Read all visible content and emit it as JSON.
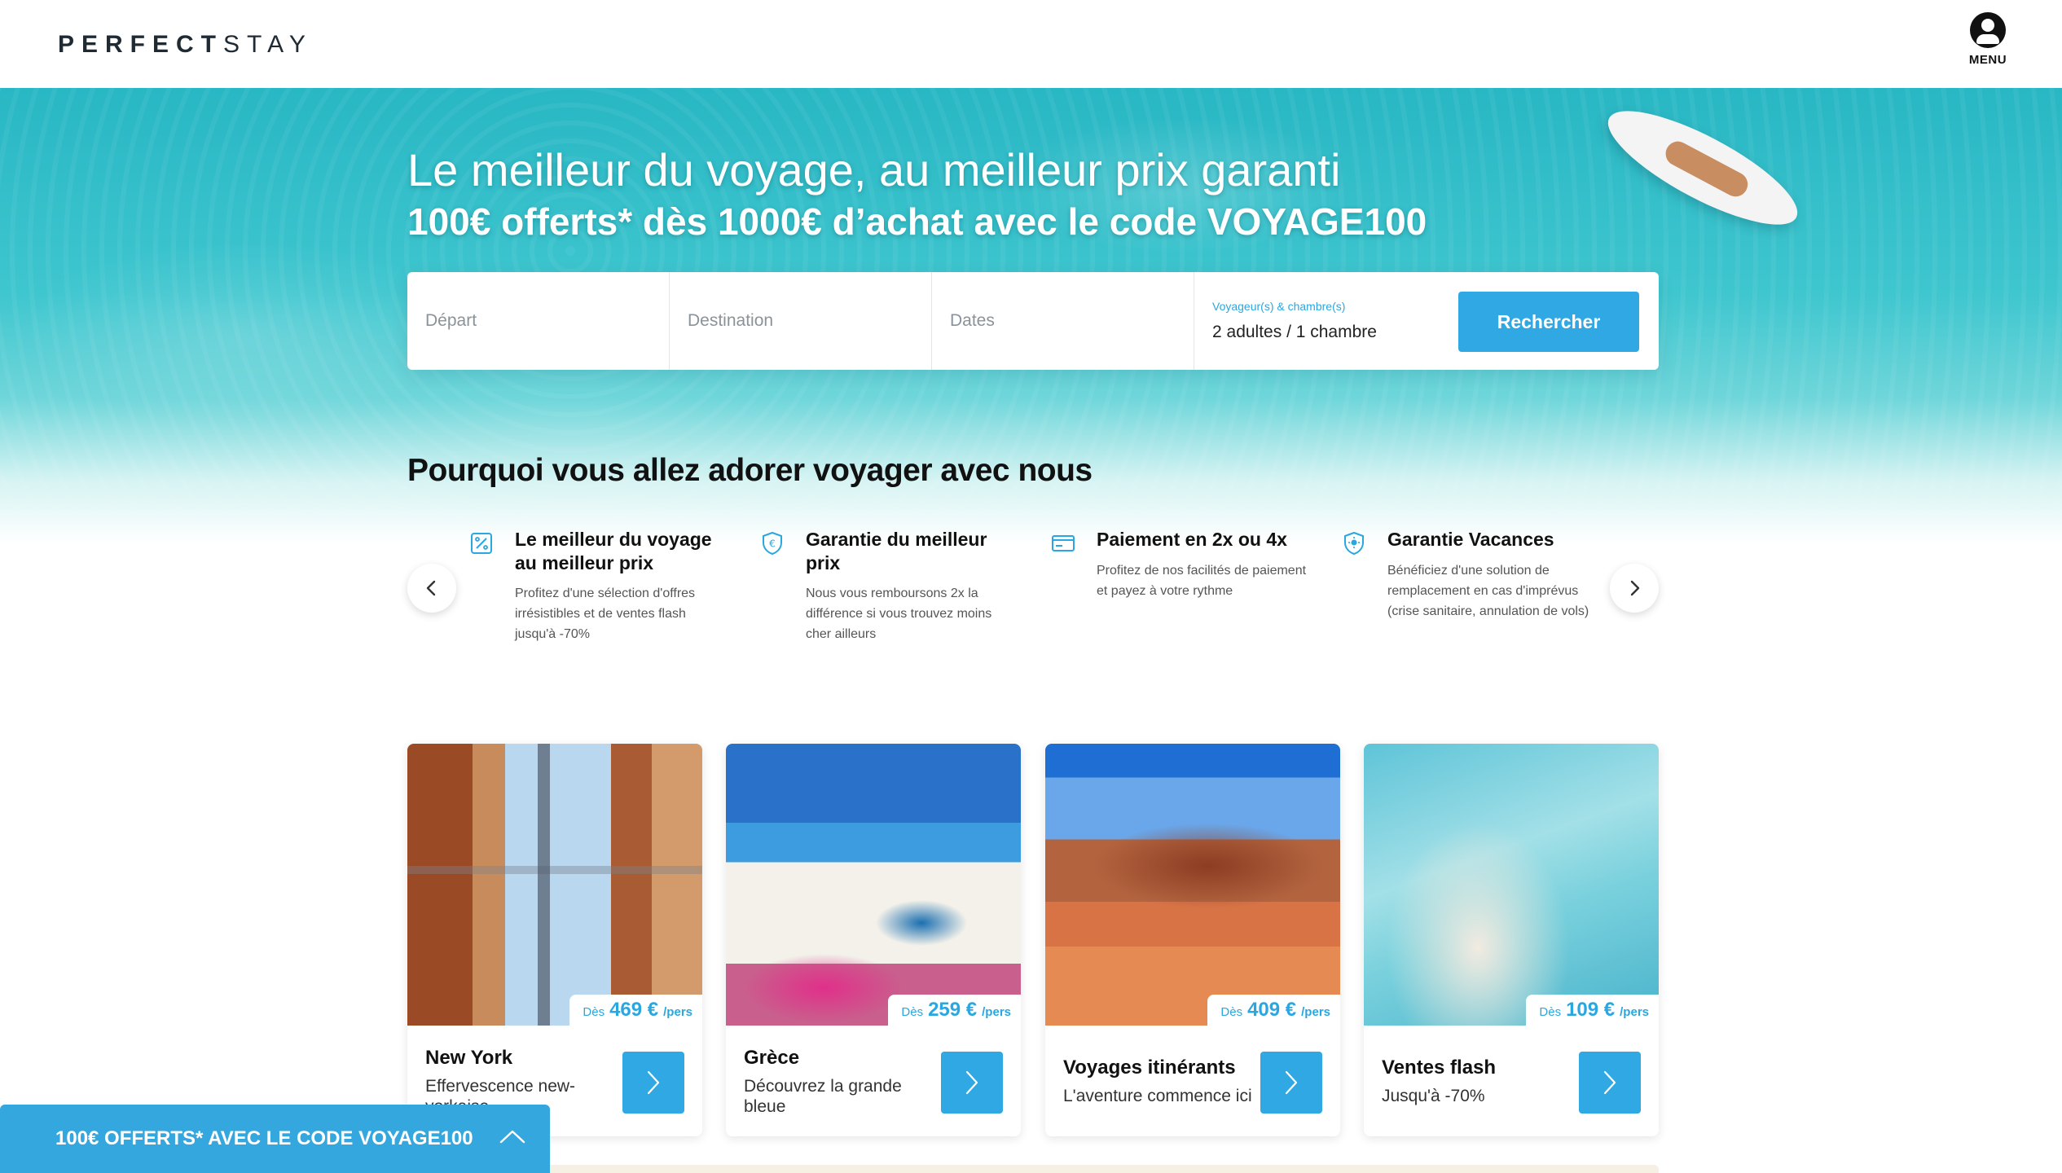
{
  "header": {
    "logo_bold": "PERFECT",
    "logo_light": "STAY",
    "menu_label": "MENU"
  },
  "hero": {
    "title": "Le meilleur du voyage, au meilleur prix garanti",
    "subtitle": "100€ offerts* dès 1000€ d’achat avec le code VOYAGE100"
  },
  "search": {
    "departure_placeholder": "Départ",
    "destination_placeholder": "Destination",
    "dates_placeholder": "Dates",
    "travelers_label": "Voyageur(s) & chambre(s)",
    "travelers_value": "2 adultes / 1 chambre",
    "button_label": "Rechercher"
  },
  "why": {
    "title": "Pourquoi vous allez adorer voyager avec nous",
    "features": [
      {
        "icon": "percent-icon",
        "title": "Le meilleur du voyage au meilleur prix",
        "text": "Profitez d'une sélection d'offres irrésistibles et de ventes flash jusqu'à -70%"
      },
      {
        "icon": "euro-shield-icon",
        "title": "Garantie du meilleur prix",
        "text": "Nous vous remboursons 2x la différence si vous trouvez moins cher ailleurs"
      },
      {
        "icon": "credit-card-icon",
        "title": "Paiement en 2x ou 4x",
        "text": "Profitez de nos facilités de paiement et payez à votre rythme"
      },
      {
        "icon": "sun-shield-icon",
        "title": "Garantie Vacances",
        "text": "Bénéficiez d'une solution de remplacement en cas d'imprévus (crise sanitaire, annulation de vols)"
      }
    ]
  },
  "cards": [
    {
      "title": "New York",
      "desc": "Effervescence new-yorkaise",
      "price_prefix": "Dès",
      "price": "469 €",
      "price_suffix": "/pers"
    },
    {
      "title": "Grèce",
      "desc": "Découvrez la grande bleue",
      "price_prefix": "Dès",
      "price": "259 €",
      "price_suffix": "/pers"
    },
    {
      "title": "Voyages itinérants",
      "desc": "L'aventure commence ici",
      "price_prefix": "Dès",
      "price": "409 €",
      "price_suffix": "/pers"
    },
    {
      "title": "Ventes flash",
      "desc": "Jusqu'à -70%",
      "price_prefix": "Dès",
      "price": "109 €",
      "price_suffix": "/pers"
    }
  ],
  "promo": {
    "text": "100€ OFFERTS* AVEC LE CODE VOYAGE100"
  },
  "colors": {
    "accent": "#2fa8e4",
    "text_dark": "#111111",
    "sea": "#3fc6cf"
  }
}
